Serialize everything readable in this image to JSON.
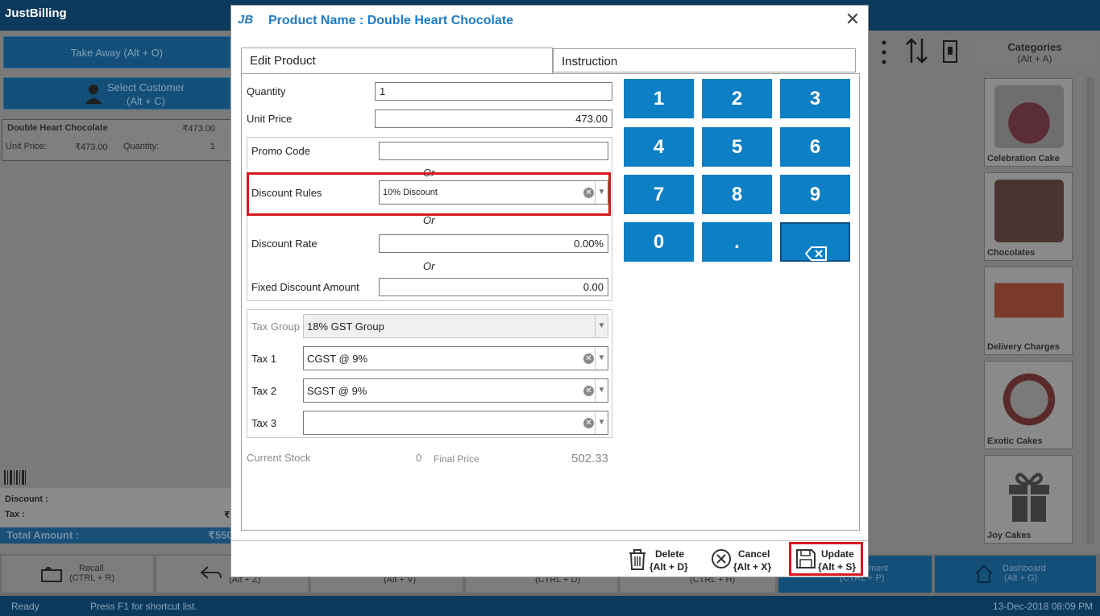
{
  "app": {
    "logo": "JustBilling",
    "take_away": "Take Away (Alt + O)",
    "select_customer": "Select Customer",
    "select_customer_shortcut": "(Alt + C)",
    "item": {
      "name": "Double Heart Chocolate",
      "price": "₹473.00",
      "unit_price_label": "Unit Price:",
      "unit_price_value": "₹473.00",
      "quantity_label": "Quantity:",
      "quantity_value": "1"
    },
    "discount_label": "Discount :",
    "tax_label": "Tax :",
    "tax_value": "₹",
    "total_label": "Total Amount :",
    "total_value": "₹550",
    "categories_label": "Categories",
    "categories_shortcut": "(Alt + A)",
    "categories": [
      {
        "name": "Celebration Cake"
      },
      {
        "name": "Chocolates"
      },
      {
        "name": "Delivery Charges"
      },
      {
        "name": "Exotic Cakes"
      },
      {
        "name": "Joy Cakes"
      }
    ],
    "bottom": {
      "recall": "Recall",
      "recall_shortcut": "(CTRL + R)",
      "b2": "(Alt + Z)",
      "b3": "(Alt + V)",
      "b4": "(CTRL + D)",
      "b5": "(CTRL + H)",
      "payment": "ment",
      "payment_shortcut": "(CTRL + P)",
      "dashboard": "Dashboard",
      "dashboard_shortcut": "(Alt + G)"
    },
    "status": {
      "ready": "Ready",
      "hint": "Press F1 for shortcut list.",
      "datetime": "13-Dec-2018 08:09 PM"
    }
  },
  "dialog": {
    "logo": "JB",
    "title": "Product Name : Double Heart Chocolate",
    "close": "✕",
    "tabs": [
      "Edit Product",
      "Instruction"
    ],
    "quantity_label": "Quantity",
    "quantity_value": "1",
    "unit_price_label": "Unit Price",
    "unit_price_value": "473.00",
    "promo_label": "Promo Code",
    "promo_value": "",
    "or_label": "Or",
    "discount_rules_label": "Discount Rules",
    "discount_rules_value": "10% Discount",
    "discount_rate_label": "Discount Rate",
    "discount_rate_value": "0.00%",
    "fixed_discount_label": "Fixed Discount Amount",
    "fixed_discount_value": "0.00",
    "tax_group_label": "Tax Group",
    "tax_group_value": "18% GST Group",
    "tax1_label": "Tax 1",
    "tax1_value": "CGST @ 9%",
    "tax2_label": "Tax 2",
    "tax2_value": "SGST @ 9%",
    "tax3_label": "Tax 3",
    "tax3_value": "",
    "current_stock_label": "Current Stock",
    "current_stock_value": "0",
    "final_price_label": "Final Price",
    "final_price_value": "502.33",
    "keypad": [
      "1",
      "2",
      "3",
      "4",
      "5",
      "6",
      "7",
      "8",
      "9",
      "0",
      "."
    ],
    "actions": {
      "delete": "Delete",
      "delete_shortcut": "{Alt + D}",
      "cancel": "Cancel",
      "cancel_shortcut": "{Alt + X}",
      "update": "Update",
      "update_shortcut": "{Alt + S}"
    },
    "highlight_color": "#d7191f",
    "accent_color": "#0d7fc4"
  }
}
